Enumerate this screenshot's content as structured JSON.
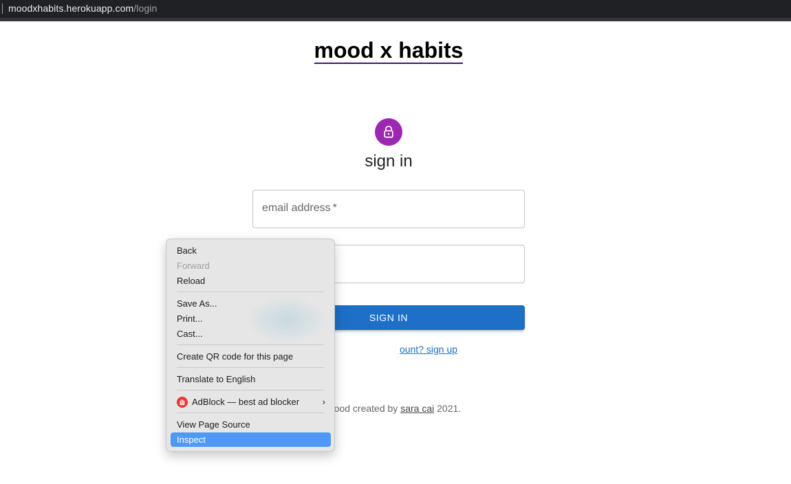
{
  "browser": {
    "url_host": "moodxhabits.herokuapp.com",
    "url_path": "/login"
  },
  "page": {
    "brand": "mood x habits",
    "heading": "sign in",
    "email_label": "email address",
    "required_mark": "*",
    "signin_button": "SIGN IN",
    "signup_link": "ount? sign up",
    "footer_prefix": "© mood created by",
    "footer_author": "sara cai",
    "footer_suffix": "2021."
  },
  "context_menu": {
    "items": [
      {
        "label": "Back"
      },
      {
        "label": "Forward"
      },
      {
        "label": "Reload"
      },
      {
        "label": "Save As..."
      },
      {
        "label": "Print..."
      },
      {
        "label": "Cast..."
      },
      {
        "label": "Create QR code for this page"
      },
      {
        "label": "Translate to English"
      },
      {
        "label": "AdBlock — best ad blocker"
      },
      {
        "label": "View Page Source"
      },
      {
        "label": "Inspect"
      }
    ],
    "submenu_arrow": "›"
  },
  "colors": {
    "avatar": "#9c27b0",
    "primary": "#1e6fc7",
    "menu_highlight": "#4f99f5"
  }
}
